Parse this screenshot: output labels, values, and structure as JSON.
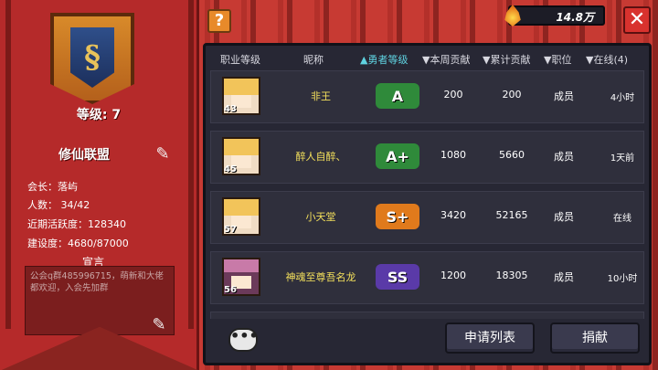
{
  "guild": {
    "level_text": "等级: 7",
    "name": "修仙联盟",
    "leader": "会长：落屿",
    "members": "人数： 34/42",
    "activity": "近期活跃度：128340",
    "construction": "建设度：4680/87000",
    "declaration_title": "宣言",
    "declaration_text": "公会q群485996715，萌新和大佬都欢迎，入会先加群"
  },
  "top_bar": {
    "help_label": "?",
    "currency_value": "14.8万",
    "close_label": "✕"
  },
  "table": {
    "headers": {
      "class_level": "职业等级",
      "nickname": "昵称",
      "hero_level": "▲勇者等级",
      "weekly": "▼本周贡献",
      "total": "▼累计贡献",
      "role": "▼职位",
      "online": "▼在线(4)"
    },
    "rows": [
      {
        "level": "43",
        "name": "非王",
        "badge": "A",
        "weekly": "200",
        "total": "200",
        "role": "成员",
        "online": "4小时"
      },
      {
        "level": "45",
        "name": "醉人自醉、",
        "badge": "A+",
        "weekly": "1080",
        "total": "5660",
        "role": "成员",
        "online": "1天前"
      },
      {
        "level": "57",
        "name": "小天堂",
        "badge": "S+",
        "weekly": "3420",
        "total": "52165",
        "role": "成员",
        "online": "在线"
      },
      {
        "level": "56",
        "name": "神魂至尊吾名龙",
        "badge": "SS",
        "weekly": "1200",
        "total": "18305",
        "role": "成员",
        "online": "10小时"
      }
    ]
  },
  "buttons": {
    "apply_list": "申请列表",
    "donate": "捐献",
    "chat": "•••"
  },
  "colors": {
    "badge_A": "#2f8a3a",
    "badge_S": "#e07a1c",
    "badge_SS": "#5a3aa8",
    "sort_active": "#5fd2e0",
    "name_text": "#f4e05c"
  }
}
